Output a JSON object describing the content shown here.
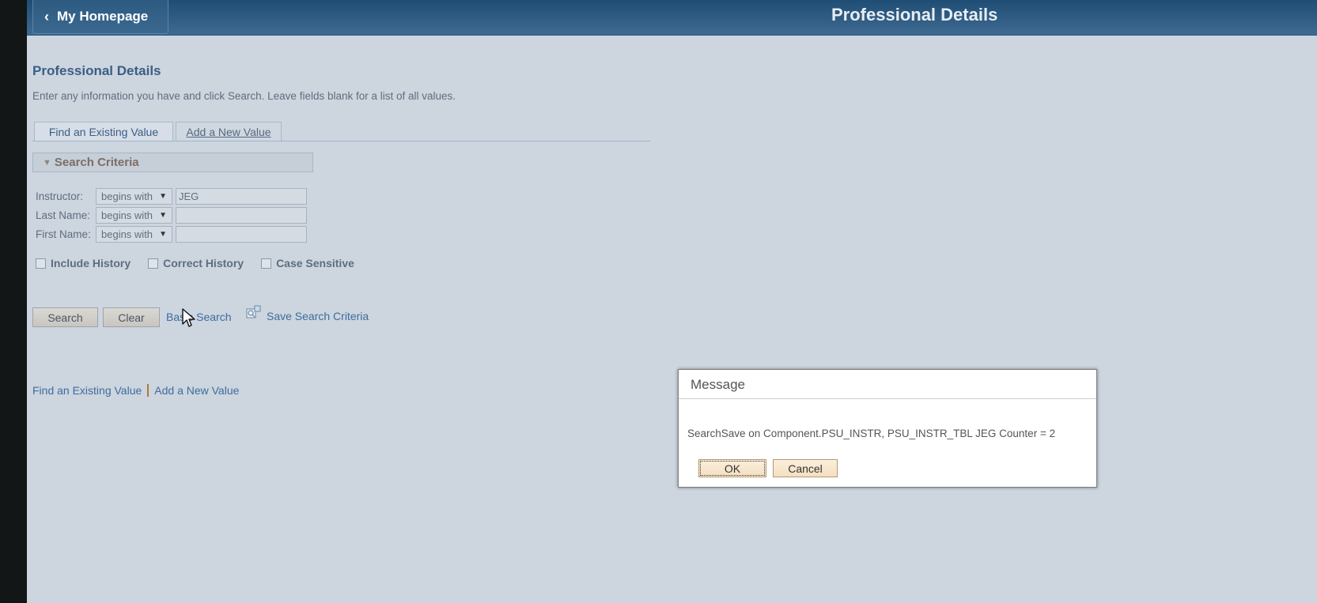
{
  "header": {
    "home_label": "My Homepage",
    "page_heading": "Professional Details"
  },
  "content": {
    "title": "Professional Details",
    "instructions": "Enter any information you have and click Search. Leave fields blank for a list of all values.",
    "tabs": [
      {
        "label": "Find an Existing Value"
      },
      {
        "label": "Add a New Value"
      }
    ],
    "search_criteria_label": "Search Criteria",
    "fields": [
      {
        "label": "Instructor:",
        "operator": "begins with",
        "value": "JEG"
      },
      {
        "label": "Last Name:",
        "operator": "begins with",
        "value": ""
      },
      {
        "label": "First Name:",
        "operator": "begins with",
        "value": ""
      }
    ],
    "checkboxes": [
      {
        "label": "Include History",
        "checked": false
      },
      {
        "label": "Correct History",
        "checked": false
      },
      {
        "label": "Case Sensitive",
        "checked": false
      }
    ],
    "buttons": {
      "search": "Search",
      "clear": "Clear"
    },
    "links": {
      "basic_search": "Basic Search",
      "save_search_criteria": "Save Search Criteria"
    },
    "bottom_links": [
      "Find an Existing Value",
      "Add a New Value"
    ]
  },
  "dialog": {
    "title": "Message",
    "message": "SearchSave on Component.PSU_INSTR, PSU_INSTR_TBL JEG Counter = 2",
    "ok_label": "OK",
    "cancel_label": "Cancel"
  }
}
